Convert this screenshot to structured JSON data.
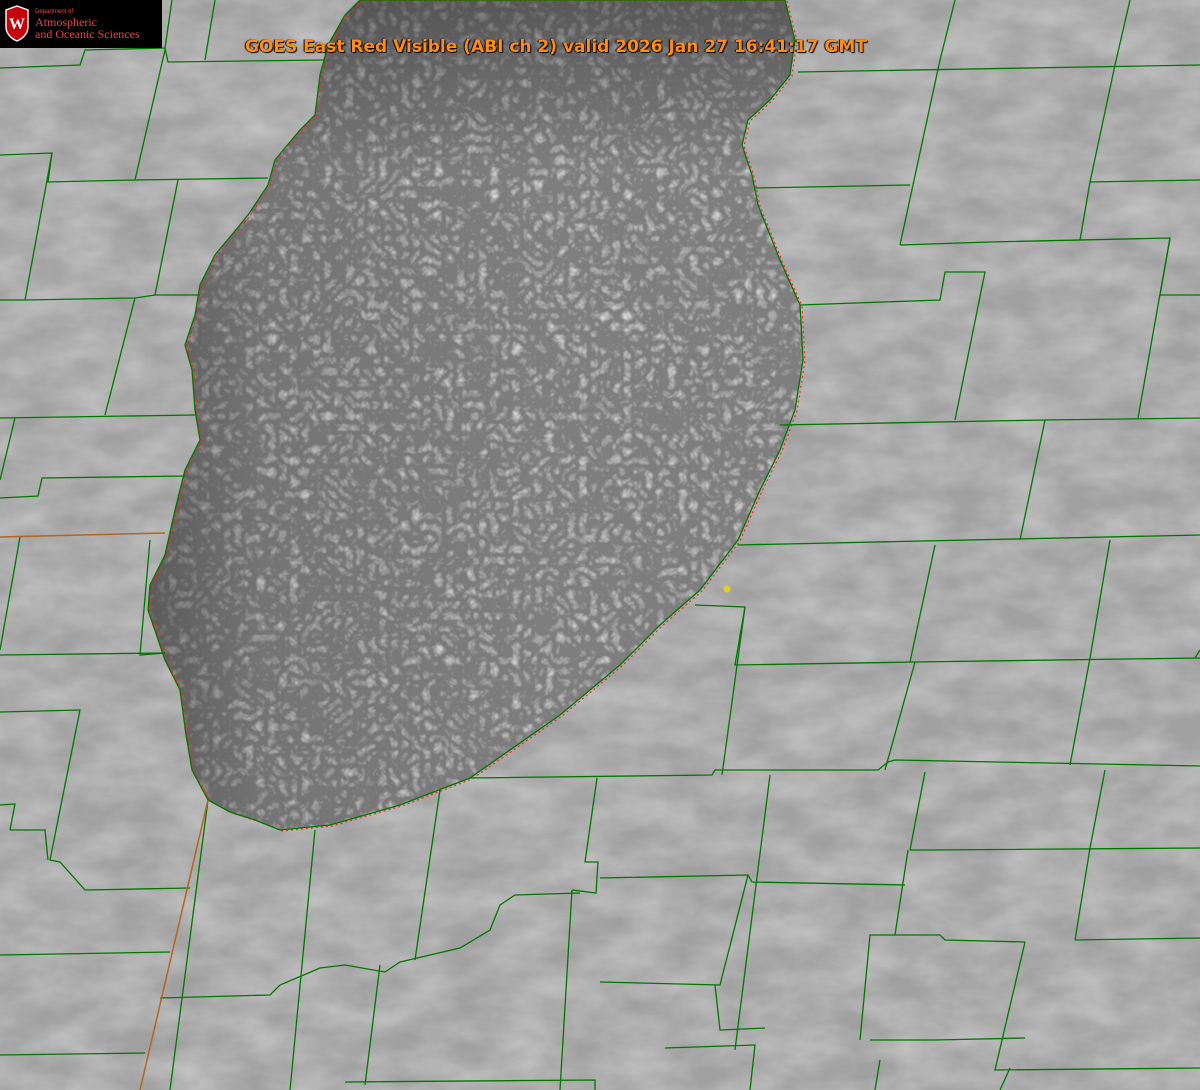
{
  "title": "GOES East Red Visible (ABI ch 2) valid 2026 Jan 27 16:41:17 GMT",
  "logo": {
    "department": "Department of",
    "line1": "Atmospheric",
    "line2": "and Oceanic Sciences",
    "shield_letter": "W"
  },
  "colors": {
    "title": "#ff8c1a",
    "logo_text": "#e8454a",
    "shield": "#c5050c",
    "county_lines": "#007700",
    "state_line": "#b5651d",
    "lake_shore_dotted": "#ff2020",
    "station_marker": "#dcd21e",
    "land_cloud": "#a2a2a2",
    "lake_cloud": "#848484"
  },
  "map": {
    "product": "red visible satellite image",
    "overlays": [
      "county-boundaries",
      "state-boundary",
      "lake-shoreline",
      "station-marker"
    ]
  }
}
